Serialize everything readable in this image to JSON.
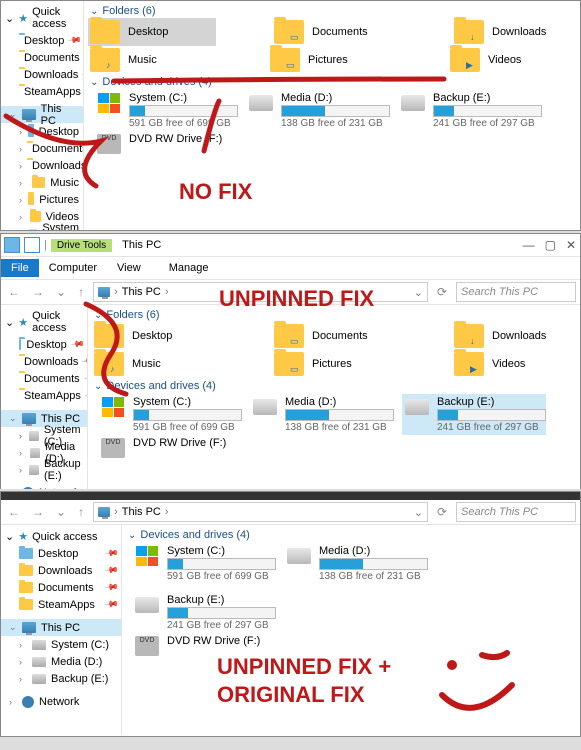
{
  "annotations": {
    "no_fix": "NO FIX",
    "unpinned_fix": "UNPINNED FIX",
    "combined_fix": "UNPINNED FIX + ORIGINAL FIX"
  },
  "nav": {
    "quick_access": "Quick access",
    "this_pc": "This PC",
    "network": "Network",
    "items_full": [
      "Desktop",
      "Documents",
      "Downloads",
      "SteamApps"
    ],
    "pc_children_full": [
      "Desktop",
      "Documents",
      "Downloads",
      "Music",
      "Pictures",
      "Videos",
      "System (C:)",
      "Media (D:)",
      "Backup (E:)"
    ],
    "nav2_qa": [
      "Desktop",
      "Downloads",
      "Documents",
      "SteamApps"
    ],
    "nav2_pc": [
      "System (C:)",
      "Media (D:)",
      "Backup (E:)"
    ]
  },
  "groups": {
    "folders": "Folders (6)",
    "drives": "Devices and drives (4)"
  },
  "folders": [
    {
      "label": "Desktop",
      "ovr": ""
    },
    {
      "label": "Documents",
      "ovr": "▭"
    },
    {
      "label": "Downloads",
      "ovr": "↓"
    },
    {
      "label": "Music",
      "ovr": "♪"
    },
    {
      "label": "Pictures",
      "ovr": "▭"
    },
    {
      "label": "Videos",
      "ovr": "▶"
    }
  ],
  "drives": [
    {
      "name": "System (C:)",
      "free": "591 GB free of 699 GB",
      "pct": 14,
      "type": "win"
    },
    {
      "name": "Media (D:)",
      "free": "138 GB free of 231 GB",
      "pct": 40,
      "type": "hd"
    },
    {
      "name": "Backup (E:)",
      "free": "241 GB free of 297 GB",
      "pct": 19,
      "type": "hd"
    },
    {
      "name": "DVD RW Drive (F:)",
      "free": "",
      "pct": 0,
      "type": "dvd"
    }
  ],
  "window": {
    "title": "This PC",
    "drive_tools": "Drive Tools",
    "file_tab": "File",
    "computer_tab": "Computer",
    "view_tab": "View",
    "manage_tab": "Manage",
    "crumb": "This PC",
    "search_ph": "Search This PC"
  }
}
